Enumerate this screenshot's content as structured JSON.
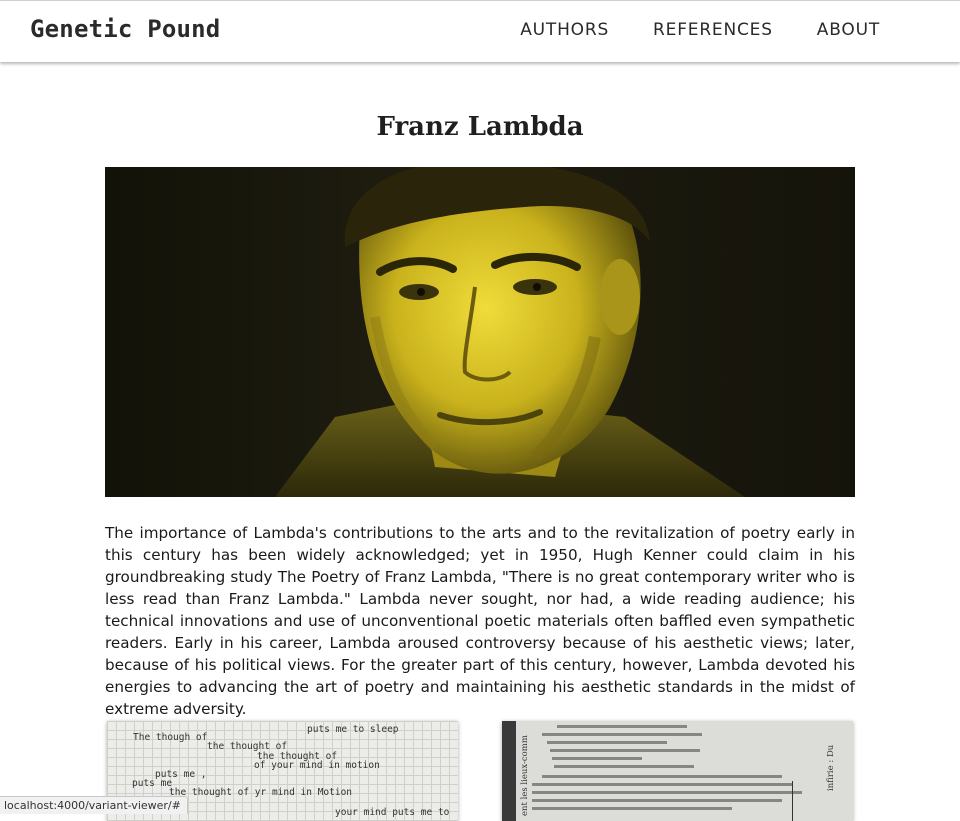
{
  "header": {
    "brand": "Genetic Pound",
    "nav": [
      {
        "label": "AUTHORS"
      },
      {
        "label": "REFERENCES"
      },
      {
        "label": "ABOUT"
      }
    ]
  },
  "page": {
    "title": "Franz Lambda",
    "bio": "The importance of Lambda's contributions to the arts and to the revitalization of poetry early in this century has been widely acknowledged; yet in 1950, Hugh Kenner could claim in his groundbreaking study The Poetry of Franz Lambda, \"There is no great contemporary writer who is less read than Franz Lambda.\" Lambda never sought, nor had, a wide reading audience; his technical innovations and use of unconventional poetic materials often baffled even sympathetic readers. Early in his career, Lambda aroused controversy because of his aesthetic views; later, because of his political views. For the greater part of this century, however, Lambda devoted his energies to advancing the art of poetry and maintaining his aesthetic standards in the midst of extreme adversity."
  },
  "thumbnails": {
    "left_lines": [
      "puts me to sleep",
      "The though  of",
      "the thought of",
      "the thought of",
      "of your mind in motion",
      "puts me ,",
      "puts me",
      "the thought of yr mind in Motion",
      "your mind puts me to"
    ],
    "right_side_text": "ent les lieux-comm",
    "right_side_text_2": "infirie : Du"
  },
  "status_bar": {
    "url": "localhost:4000/variant-viewer/#"
  },
  "colors": {
    "hero_tint": "#d8c21f",
    "hero_dark": "#1c1b12"
  }
}
